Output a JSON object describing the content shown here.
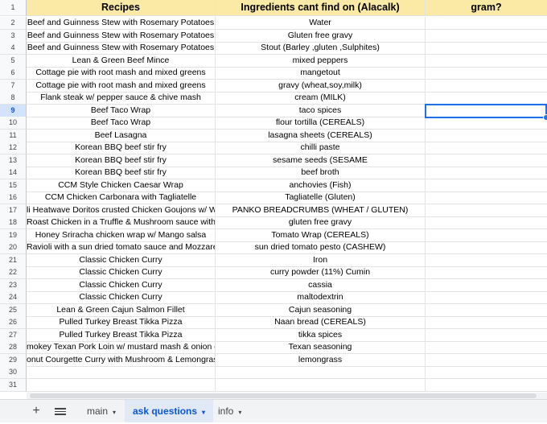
{
  "columns": {
    "a": "Recipes",
    "b": "Ingredients cant find on (Alacalk)",
    "c": "gram?"
  },
  "rows": [
    {
      "n": "2",
      "a": "Beef and Guinness Stew with Rosemary Potatoes",
      "b": "Water"
    },
    {
      "n": "3",
      "a": "Beef and Guinness Stew with Rosemary Potatoes",
      "b": "Gluten free gravy"
    },
    {
      "n": "4",
      "a": "Beef and Guinness Stew with Rosemary Potatoes",
      "b": "Stout (Barley ,gluten ,Sulphites)"
    },
    {
      "n": "5",
      "a": "Lean & Green Beef Mince",
      "b": "mixed peppers"
    },
    {
      "n": "6",
      "a": "Cottage pie with root mash and mixed greens",
      "b": "mangetout"
    },
    {
      "n": "7",
      "a": "Cottage pie with root mash and mixed greens",
      "b": "gravy (wheat,soy,milk)"
    },
    {
      "n": "8",
      "a": "Flank steak w/ pepper sauce & chive mash",
      "b": "cream (MILK)"
    },
    {
      "n": "9",
      "a": "Beef Taco Wrap",
      "b": "taco spices"
    },
    {
      "n": "10",
      "a": "Beef Taco Wrap",
      "b": "flour tortilla (CEREALS)"
    },
    {
      "n": "11",
      "a": "Beef Lasagna",
      "b": "lasagna sheets (CEREALS)"
    },
    {
      "n": "12",
      "a": "Korean BBQ beef stir fry",
      "b": "chilli paste"
    },
    {
      "n": "13",
      "a": "Korean BBQ beef stir fry",
      "b": "sesame seeds (SESAME"
    },
    {
      "n": "14",
      "a": "Korean BBQ beef stir fry",
      "b": "beef broth"
    },
    {
      "n": "15",
      "a": "CCM Style Chicken Caesar Wrap",
      "b": "anchovies (Fish)"
    },
    {
      "n": "16",
      "a": "CCM Chicken Carbonara with Tagliatelle",
      "b": "Tagliatelle (Gluten)"
    },
    {
      "n": "17",
      "a": "li Heatwave Doritos crusted Chicken Goujons w/ Wec",
      "b": "PANKO BREADCRUMBS (WHEAT / GLUTEN)"
    },
    {
      "n": "18",
      "a": "Roast Chicken in a Truffle & Mushroom sauce with R",
      "b": "gluten free gravy"
    },
    {
      "n": "19",
      "a": "Honey Sriracha chicken wrap w/ Mango salsa",
      "b": "Tomato Wrap (CEREALS)"
    },
    {
      "n": "20",
      "a": "Ravioli with a sun dried tomato sauce and Mozzarella",
      "b": "sun dried tomato pesto (CASHEW)"
    },
    {
      "n": "21",
      "a": "Classic Chicken Curry",
      "b": "Iron"
    },
    {
      "n": "22",
      "a": "Classic Chicken Curry",
      "b": "curry powder (11%) Cumin"
    },
    {
      "n": "23",
      "a": "Classic Chicken Curry",
      "b": "cassia"
    },
    {
      "n": "24",
      "a": "Classic Chicken Curry",
      "b": "maltodextrin"
    },
    {
      "n": "25",
      "a": "Lean & Green Cajun Salmon Fillet",
      "b": "Cajun seasoning"
    },
    {
      "n": "26",
      "a": "Pulled Turkey Breast Tikka Pizza",
      "b": "Naan bread (CEREALS)"
    },
    {
      "n": "27",
      "a": "Pulled Turkey Breast Tikka Pizza",
      "b": "tikka spices"
    },
    {
      "n": "28",
      "a": "mokey Texan Pork Loin w/ mustard mash & onion gra",
      "b": "Texan seasoning"
    },
    {
      "n": "29",
      "a": "onut Courgette Curry with Mushroom & Lemongrass F",
      "b": "lemongrass"
    },
    {
      "n": "30",
      "a": "",
      "b": ""
    },
    {
      "n": "31",
      "a": "",
      "b": ""
    }
  ],
  "header_row_number": "1",
  "selected_row": "9",
  "tabs": [
    {
      "label": "main"
    },
    {
      "label": "ask questions"
    },
    {
      "label": "info"
    }
  ],
  "add_sheet_label": "+",
  "caret": "▾",
  "colors": {
    "header_bg": "#fbe9a6",
    "selection": "#1a73e8",
    "active_tab": "#0b57d0"
  }
}
